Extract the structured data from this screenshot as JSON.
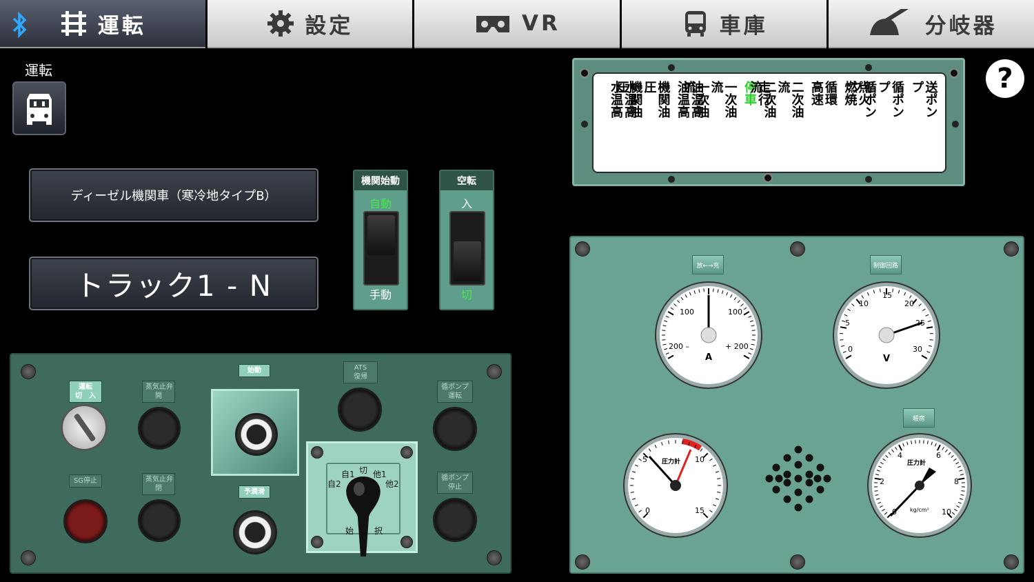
{
  "tabs": [
    {
      "label": "運転",
      "icon": "track-icon",
      "active": true
    },
    {
      "label": "設定",
      "icon": "gear-icon",
      "active": false
    },
    {
      "label": "VR",
      "icon": "vr-headset-icon",
      "active": false
    },
    {
      "label": "車庫",
      "icon": "train-front-icon",
      "active": false
    },
    {
      "label": "分岐器",
      "icon": "switch-lever-icon",
      "active": false
    }
  ],
  "mode": {
    "label": "運転",
    "icon": "locomotive-icon"
  },
  "loco_name": "ディーゼル機関車（寒冷地タイプB）",
  "track_name": "トラック1 - N",
  "toggles": [
    {
      "title": "機関始動",
      "up": "自動",
      "down": "手動"
    },
    {
      "title": "空転",
      "up": "入",
      "down": "切"
    }
  ],
  "warning_lamps": [
    {
      "top": "水温高",
      "bottom": "水温高"
    },
    {
      "top": "機関油圧",
      "bottom": "機関油圧"
    },
    {
      "top": "油温高",
      "bottom": "油温高"
    },
    {
      "top": "一次油流",
      "bottom": "一次油流"
    },
    {
      "top": "走行",
      "bottom": "停車",
      "lit_bottom": true
    },
    {
      "top": "二次油流",
      "bottom": "二次油流"
    },
    {
      "top": "循環",
      "bottom": "高速"
    },
    {
      "top": "点火",
      "bottom": "燃焼"
    },
    {
      "top": "循ポンプ",
      "bottom": "循ポンプ"
    },
    {
      "top": "送ポンプ",
      "bottom": ""
    }
  ],
  "help_label": "?",
  "gauges": {
    "ammeter": {
      "tag": "放←→充",
      "labels": [
        "100",
        "100",
        "200 –",
        "+ 200"
      ],
      "unit": "A",
      "value": 0.0
    },
    "voltmeter": {
      "tag": "制御回路",
      "labels": [
        "0",
        "5",
        "10",
        "15",
        "20",
        "25",
        "30"
      ],
      "unit": "V",
      "value": 26
    },
    "pressure1": {
      "labels": [
        "0",
        "5",
        "10",
        "15"
      ],
      "title": "圧力計",
      "unit": "kg/cm²"
    },
    "pressure2": {
      "tag": "暖房",
      "labels": [
        "0",
        "2",
        "4",
        "6",
        "8",
        "10"
      ],
      "title": "圧力計",
      "sub": "暖房",
      "unit": "kg/cm²",
      "value": 7
    }
  },
  "controls": {
    "key_label": "運転\n切　入",
    "steam1_label": "蒸気止弁\n開",
    "start_label": "始動",
    "ats_label": "ATS\n復帰",
    "pump_run_label": "循ポンプ\n運転",
    "sg_stop_label": "SG停止",
    "steam2_label": "蒸気止弁\n閉",
    "preheat_label": "予潤滑",
    "pump_stop_label": "循ポンプ\n停止",
    "selector_labels": [
      "切",
      "自1",
      "他1",
      "自2",
      "他2",
      "始",
      "択"
    ]
  }
}
